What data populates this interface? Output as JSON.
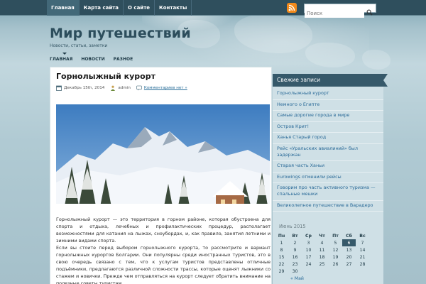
{
  "topbar": {
    "nav": [
      "Главная",
      "Карта сайта",
      "О сайте",
      "Контакты"
    ],
    "search_placeholder": "Поиск",
    "rss_icon": "rss-icon",
    "search_icon": "search-icon"
  },
  "header": {
    "title": "Мир путешествий",
    "description": "Новости, статьи, заметки",
    "categories": [
      "ГЛАВНАЯ",
      "НОВОСТИ",
      "РАЗНОЕ"
    ]
  },
  "post": {
    "title": "Горнолыжный курорт",
    "date": "Декабрь 15th, 2014",
    "author": "admin",
    "comments": "Комментариев нет »",
    "body_p1": "Горнолыжный курорт — это территория в горном районе, которая обустроена для спорта и отдыха, лечебных и профилактических процедур, располагает возможностями для катания на лыжах, сноубордах, и, как правило, занятия летними и зимними видами спорта.",
    "body_p2": "Если вы стоите перед выбором горнолыжного курорта, то рассмотрите и вариант горнолыжных курортов Болгарии. Они популярны среди иностранных туристов, это в свою очередь связано с тем, что к услугам туристов представлены отличные подъёмники, предлагаются различной сложности трассы, которые оценят лыжники со стажем и новички. Прежде чем отправляться на курорт следует обратить внимание на полезные советы туристам."
  },
  "sidebar": {
    "recent_title": "Свежие записи",
    "recent": [
      "Горнолыжный курорт",
      "Немного о Египте",
      "Самые дорогие города в мире",
      "Остров Крит!",
      "Ханья Старый город",
      "Рейс «Уральских авиалиний» был задержан",
      "Старая часть Ханьи",
      "Eurowings отменили рейсы",
      "Говорим про часть активного туризма — спальные мешки",
      "Великолепное путешествие в Варадеро"
    ],
    "calendar": {
      "caption": "Июнь 2015",
      "headers": [
        "Пн",
        "Вт",
        "Ср",
        "Чт",
        "Пт",
        "Сб",
        "Вс"
      ],
      "rows": [
        [
          "1",
          "2",
          "3",
          "4",
          "5",
          "6",
          "7"
        ],
        [
          "8",
          "9",
          "10",
          "11",
          "12",
          "13",
          "14"
        ],
        [
          "15",
          "16",
          "17",
          "18",
          "19",
          "20",
          "21"
        ],
        [
          "22",
          "23",
          "24",
          "25",
          "26",
          "27",
          "28"
        ],
        [
          "29",
          "30",
          "",
          "",
          "",
          "",
          ""
        ]
      ],
      "today": "6",
      "prev": "« Май"
    }
  },
  "colors": {
    "topbar": "#2f4f5d",
    "title": "#2c4d5c",
    "link": "#2a6a98",
    "widget_header": "#36596a"
  }
}
